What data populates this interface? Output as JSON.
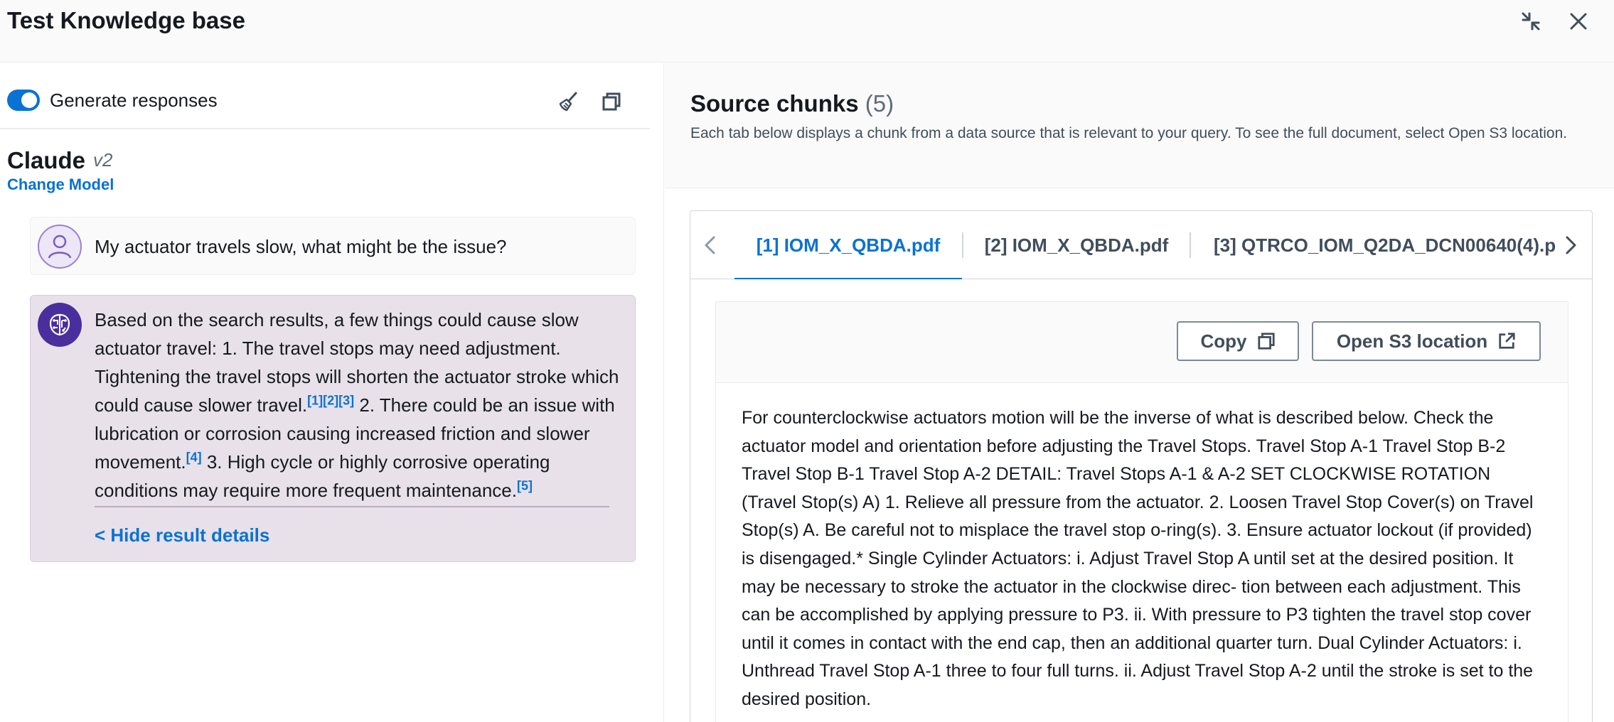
{
  "header": {
    "title": "Test Knowledge base",
    "minimize_icon": "minimize-icon",
    "close_icon": "close-icon"
  },
  "left": {
    "generate_label": "Generate responses",
    "generate_on": true,
    "clear_icon": "broom-icon",
    "copy_icon": "copy-icon",
    "model": {
      "name": "Claude",
      "version": "v2",
      "change_label": "Change Model"
    },
    "user_message": "My actuator travels slow, what might be the issue?",
    "bot_message": {
      "segments": [
        "Based on the search results, a few things could cause slow actuator travel: 1. The travel stops may need adjustment. Tightening the travel stops will shorten the actuator stroke which could cause slower travel.",
        " 2. There could be an issue with lubrication or corrosion causing increased friction and slower movement.",
        " 3. High cycle or highly corrosive operating conditions may require more frequent maintenance."
      ],
      "citations": [
        "[1]",
        "[2]",
        "[3]",
        "[4]",
        "[5]"
      ],
      "hide_label": "< Hide result details"
    }
  },
  "right": {
    "title": "Source chunks",
    "count": "(5)",
    "description": "Each tab below displays a chunk from a data source that is relevant to your query. To see the full document, select Open S3 location.",
    "tabs": [
      {
        "label": "[1] IOM_X_QBDA.pdf",
        "active": true
      },
      {
        "label": "[2] IOM_X_QBDA.pdf",
        "active": false
      },
      {
        "label": "[3] QTRCO_IOM_Q2DA_DCN00640(4).p",
        "active": false
      }
    ],
    "copy_label": "Copy",
    "open_s3_label": "Open S3 location",
    "chunk_text": "For counterclockwise actuators motion will be the inverse of what is described below. Check the actuator model and orientation before adjusting the Travel Stops. Travel Stop A-1 Travel Stop B-2 Travel Stop B-1 Travel Stop A-2 DETAIL: Travel Stops A-1 & A-2 SET CLOCKWISE ROTATION (Travel Stop(s) A) 1. Relieve all pressure from the actuator. 2. Loosen Travel Stop Cover(s) on Travel Stop(s) A. Be careful not to misplace the travel stop o-ring(s). 3. Ensure actuator lockout (if provided) is disengaged.* Single Cylinder Actuators: i. Adjust Travel Stop A until set at the desired position. It may be necessary to stroke the actuator in the clockwise direc- tion between each adjustment. This can be accomplished by applying pressure to P3. ii. With pressure to P3 tighten the travel stop cover until it comes in contact with the end cap, then an additional quarter turn. Dual Cylinder Actuators: i. Unthread Travel Stop A-1 three to four full turns. ii. Adjust Travel Stop A-2 until the stroke is set to the desired position."
  }
}
